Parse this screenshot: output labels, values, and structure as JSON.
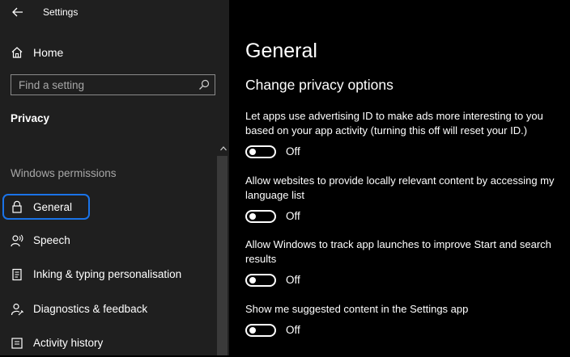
{
  "window": {
    "title": "Settings"
  },
  "nav": {
    "home_label": "Home",
    "search_placeholder": "Find a setting",
    "section_title": "Privacy",
    "group_title": "Windows permissions",
    "items": [
      {
        "label": "General",
        "icon": "lock-icon",
        "selected": true
      },
      {
        "label": "Speech",
        "icon": "speech-icon"
      },
      {
        "label": "Inking & typing personalisation",
        "icon": "inking-icon"
      },
      {
        "label": "Diagnostics & feedback",
        "icon": "diagnostics-icon"
      },
      {
        "label": "Activity history",
        "icon": "activity-history-icon"
      }
    ]
  },
  "main": {
    "title": "General",
    "subtitle": "Change privacy options",
    "settings": [
      {
        "description": "Let apps use advertising ID to make ads more interesting to you based on your app activity (turning this off will reset your ID.)",
        "state": "Off"
      },
      {
        "description": "Allow websites to provide locally relevant content by accessing my language list",
        "state": "Off"
      },
      {
        "description": "Allow Windows to track app launches to improve Start and search results",
        "state": "Off"
      },
      {
        "description": "Show me suggested content in the Settings app",
        "state": "Off"
      }
    ]
  },
  "colors": {
    "sidebar_bg": "#1f1f1f",
    "main_bg": "#000000",
    "selection_outline": "#1a73e8",
    "muted_text": "#a8a8a8"
  }
}
